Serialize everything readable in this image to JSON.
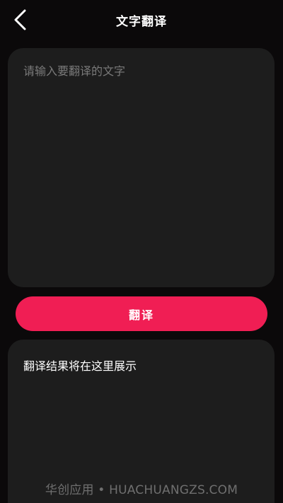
{
  "header": {
    "title": "文字翻译",
    "back_icon": "chevron-left-icon"
  },
  "input": {
    "placeholder": "请输入要翻译的文字",
    "value": ""
  },
  "translate_button": {
    "label": "翻译"
  },
  "result": {
    "text": "翻译结果将在这里展示"
  },
  "watermark": {
    "text": "华创应用 • HUACHUANGZS.COM"
  },
  "colors": {
    "background": "#0b090a",
    "card": "#1d1d1d",
    "accent": "#f01e54",
    "placeholder": "#7a7a7a",
    "text": "#ffffff"
  }
}
